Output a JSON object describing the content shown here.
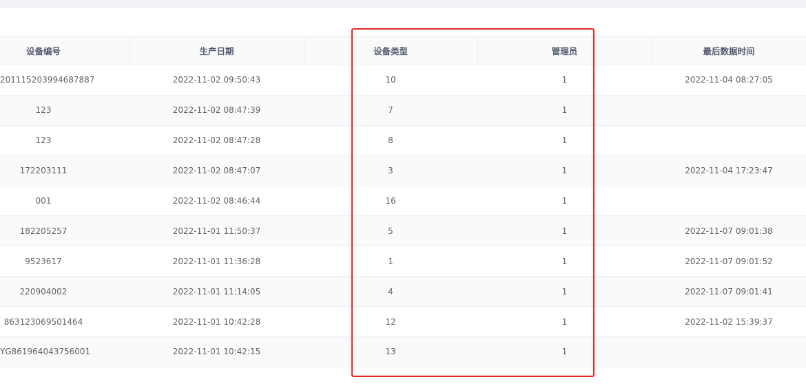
{
  "table": {
    "columns": [
      "设备编号",
      "生产日期",
      "设备类型",
      "管理员",
      "最后数据时间"
    ],
    "rows": [
      {
        "device_no": "201115203994687887",
        "production_date": "2022-11-02 09:50:43",
        "device_type": "10",
        "admin": "1",
        "last_data_time": "2022-11-04 08:27:05"
      },
      {
        "device_no": "123",
        "production_date": "2022-11-02 08:47:39",
        "device_type": "7",
        "admin": "1",
        "last_data_time": ""
      },
      {
        "device_no": "123",
        "production_date": "2022-11-02 08:47:28",
        "device_type": "8",
        "admin": "1",
        "last_data_time": ""
      },
      {
        "device_no": "172203111",
        "production_date": "2022-11-02 08:47:07",
        "device_type": "3",
        "admin": "1",
        "last_data_time": "2022-11-04 17:23:47"
      },
      {
        "device_no": "001",
        "production_date": "2022-11-02 08:46:44",
        "device_type": "16",
        "admin": "1",
        "last_data_time": ""
      },
      {
        "device_no": "182205257",
        "production_date": "2022-11-01 11:50:37",
        "device_type": "5",
        "admin": "1",
        "last_data_time": "2022-11-07 09:01:38"
      },
      {
        "device_no": "9523617",
        "production_date": "2022-11-01 11:36:28",
        "device_type": "1",
        "admin": "1",
        "last_data_time": "2022-11-07 09:01:52"
      },
      {
        "device_no": "220904002",
        "production_date": "2022-11-01 11:14:05",
        "device_type": "4",
        "admin": "1",
        "last_data_time": "2022-11-07 09:01:41"
      },
      {
        "device_no": "863123069501464",
        "production_date": "2022-11-01 10:42:28",
        "device_type": "12",
        "admin": "1",
        "last_data_time": "2022-11-02 15:39:37"
      },
      {
        "device_no": "YG861964043756001",
        "production_date": "2022-11-01 10:42:15",
        "device_type": "13",
        "admin": "1",
        "last_data_time": ""
      }
    ]
  },
  "highlight": {
    "color": "#e8282a"
  }
}
